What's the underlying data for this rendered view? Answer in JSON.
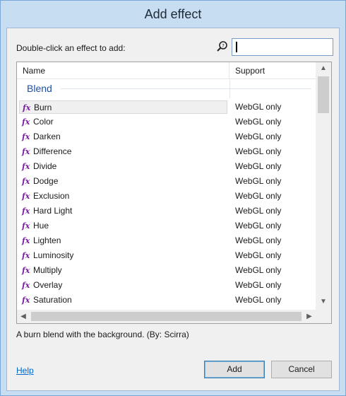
{
  "window": {
    "title": "Add effect"
  },
  "prompt": "Double-click an effect to add:",
  "search": {
    "value": "",
    "placeholder": ""
  },
  "list": {
    "columns": {
      "name": "Name",
      "support": "Support"
    },
    "group": "Blend",
    "icon_glyph": "fx",
    "selected_index": 0,
    "items": [
      {
        "name": "Burn",
        "support": "WebGL only"
      },
      {
        "name": "Color",
        "support": "WebGL only"
      },
      {
        "name": "Darken",
        "support": "WebGL only"
      },
      {
        "name": "Difference",
        "support": "WebGL only"
      },
      {
        "name": "Divide",
        "support": "WebGL only"
      },
      {
        "name": "Dodge",
        "support": "WebGL only"
      },
      {
        "name": "Exclusion",
        "support": "WebGL only"
      },
      {
        "name": "Hard Light",
        "support": "WebGL only"
      },
      {
        "name": "Hue",
        "support": "WebGL only"
      },
      {
        "name": "Lighten",
        "support": "WebGL only"
      },
      {
        "name": "Luminosity",
        "support": "WebGL only"
      },
      {
        "name": "Multiply",
        "support": "WebGL only"
      },
      {
        "name": "Overlay",
        "support": "WebGL only"
      },
      {
        "name": "Saturation",
        "support": "WebGL only"
      }
    ]
  },
  "description": "A burn blend with the background. (By: Scirra)",
  "footer": {
    "help": "Help",
    "add": "Add",
    "cancel": "Cancel"
  },
  "colors": {
    "accent": "#1e4fa8",
    "fx_icon": "#7a1fa2",
    "link": "#0066cc"
  }
}
